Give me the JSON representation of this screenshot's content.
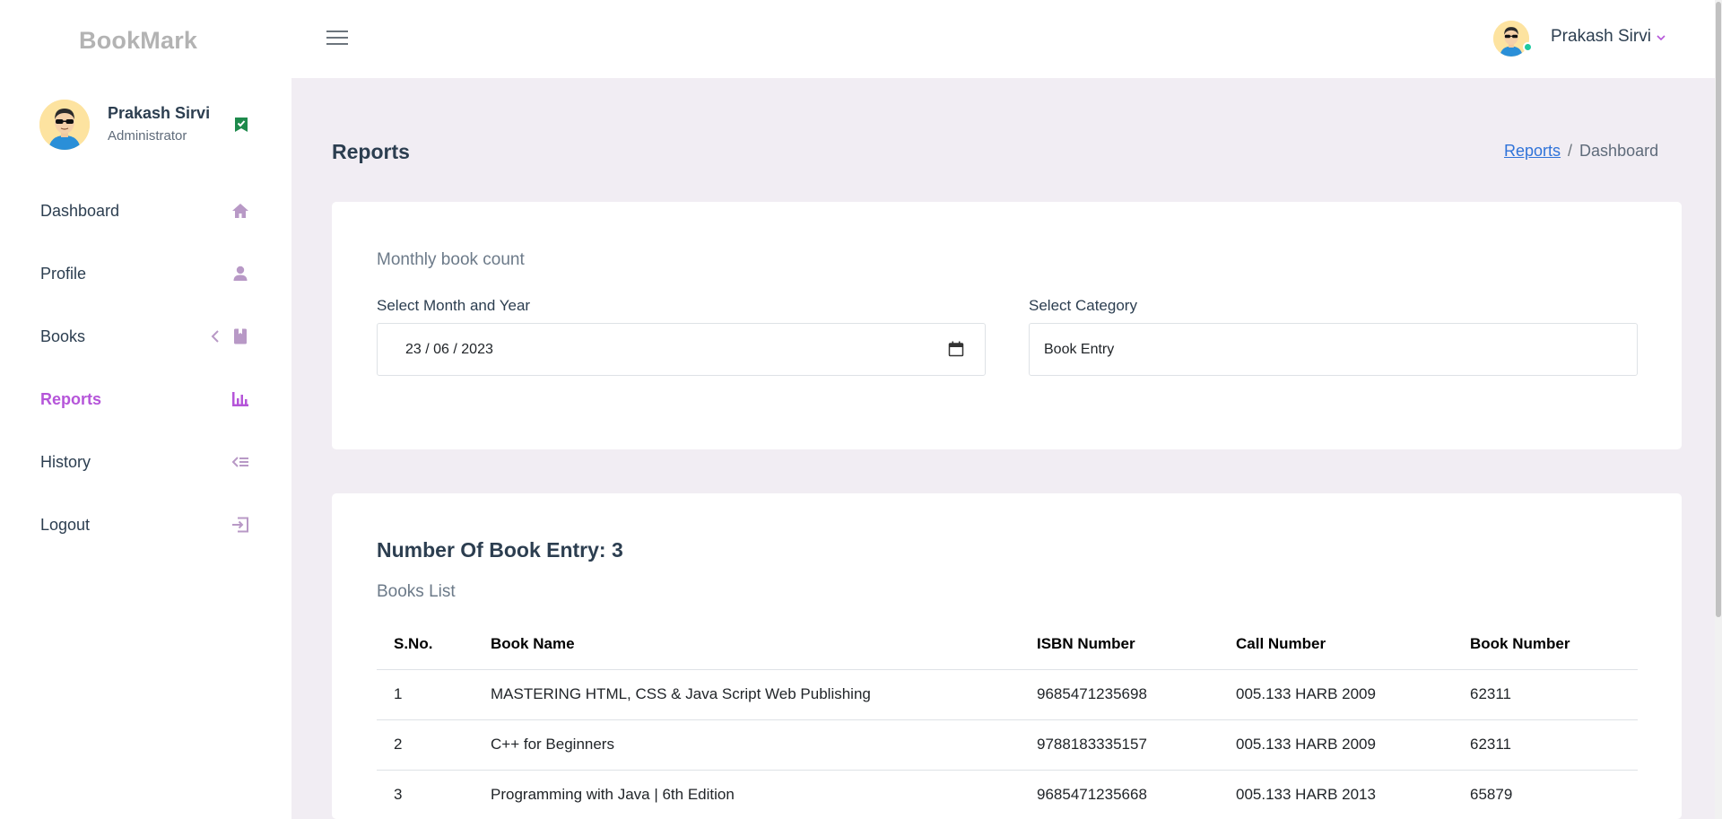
{
  "app": {
    "logo": "BookMark"
  },
  "sidebar": {
    "profile": {
      "name": "Prakash Sirvi",
      "role": "Administrator"
    },
    "items": [
      {
        "label": "Dashboard",
        "icon": "home-icon"
      },
      {
        "label": "Profile",
        "icon": "user-icon"
      },
      {
        "label": "Books",
        "icon": "book-icon"
      },
      {
        "label": "Reports",
        "icon": "bar-chart-icon",
        "active": true
      },
      {
        "label": "History",
        "icon": "history-icon"
      },
      {
        "label": "Logout",
        "icon": "logout-icon"
      }
    ]
  },
  "topbar": {
    "user_name": "Prakash Sirvi"
  },
  "page": {
    "title": "Reports",
    "breadcrumb": {
      "link": "Reports",
      "separator": "/",
      "current": "Dashboard"
    }
  },
  "filter": {
    "subtitle": "Monthly book count",
    "month_label": "Select Month and Year",
    "month_value": "23 / 06 / 2023",
    "category_label": "Select Category",
    "category_value": "Book Entry"
  },
  "books": {
    "count_title": "Number Of Book Entry: 3",
    "list_title": "Books List",
    "columns": [
      "S.No.",
      "Book Name",
      "ISBN Number",
      "Call Number",
      "Book Number"
    ],
    "rows": [
      [
        "1",
        "MASTERING HTML, CSS & Java Script Web Publishing",
        "9685471235698",
        "005.133 HARB 2009",
        "62311"
      ],
      [
        "2",
        "C++ for Beginners",
        "9788183335157",
        "005.133 HARB 2009",
        "62311"
      ],
      [
        "3",
        "Programming with Java | 6th Edition",
        "9685471235668",
        "005.133 HARB 2013",
        "65879"
      ]
    ]
  },
  "colors": {
    "accent": "#b555d9",
    "icon": "#b899c6",
    "link": "#2f73d9",
    "background": "#f1edf3",
    "online": "#1dc9a0",
    "verified": "#1e8a4c"
  }
}
